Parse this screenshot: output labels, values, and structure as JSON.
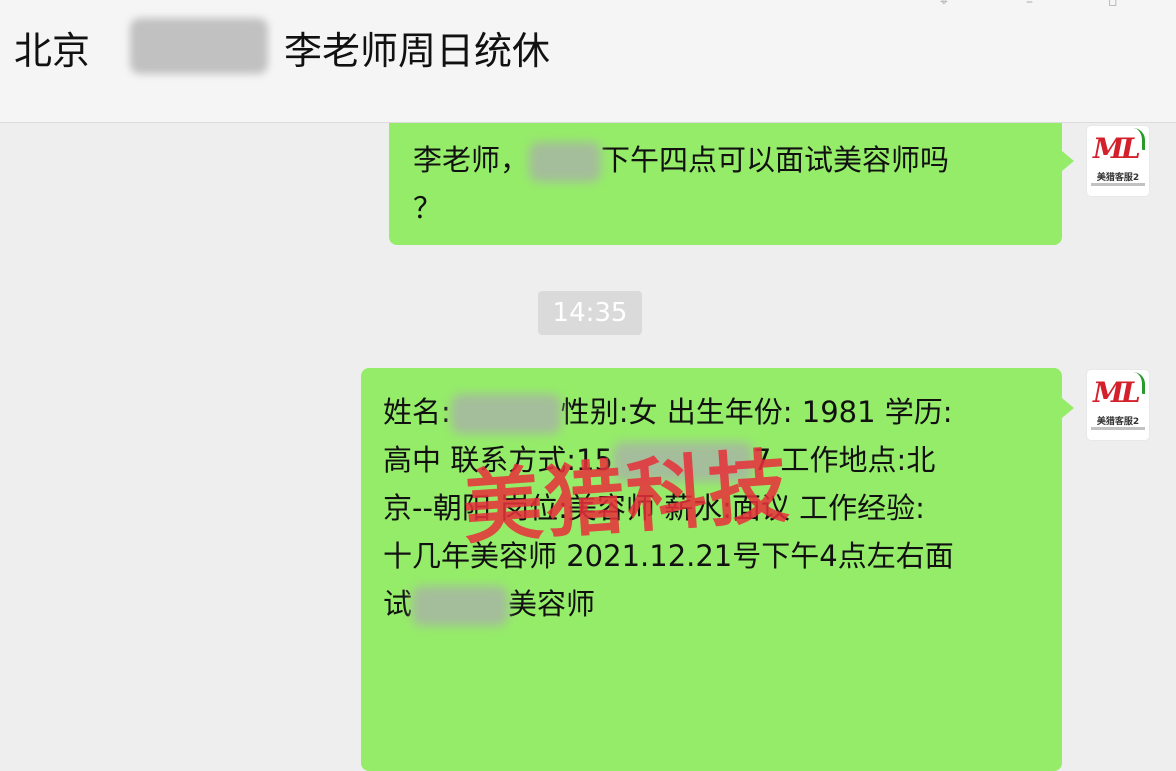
{
  "header": {
    "city": "北京",
    "title": "李老师周日统休"
  },
  "messages": [
    {
      "id": "msg1",
      "direction": "outgoing",
      "before_blur": "李老师，",
      "after_blur": "下午四点可以面试美容师吗",
      "line2": "？"
    },
    {
      "id": "timestamp",
      "time": "14:35"
    },
    {
      "id": "msg2",
      "direction": "outgoing",
      "line1_a": "姓名:",
      "line1_b": "性别:女 出生年份: 1981 学历:",
      "line2_a": "高中 联系方式:15",
      "line2_b": "7 工作地点:北",
      "line3": "京--朝阳 岗位:美容师 薪水:面议 工作经验:",
      "line4": "十几年美容师 2021.12.21号下午4点左右面",
      "line5_a": "试",
      "line5_b": "美容师"
    }
  ],
  "avatar": {
    "logo_text": "ML",
    "name": "美猎客服2"
  },
  "watermark": "美猎科技",
  "colors": {
    "bubble": "#95ec69",
    "background": "#eeeeee",
    "watermark": "#e8303a"
  }
}
